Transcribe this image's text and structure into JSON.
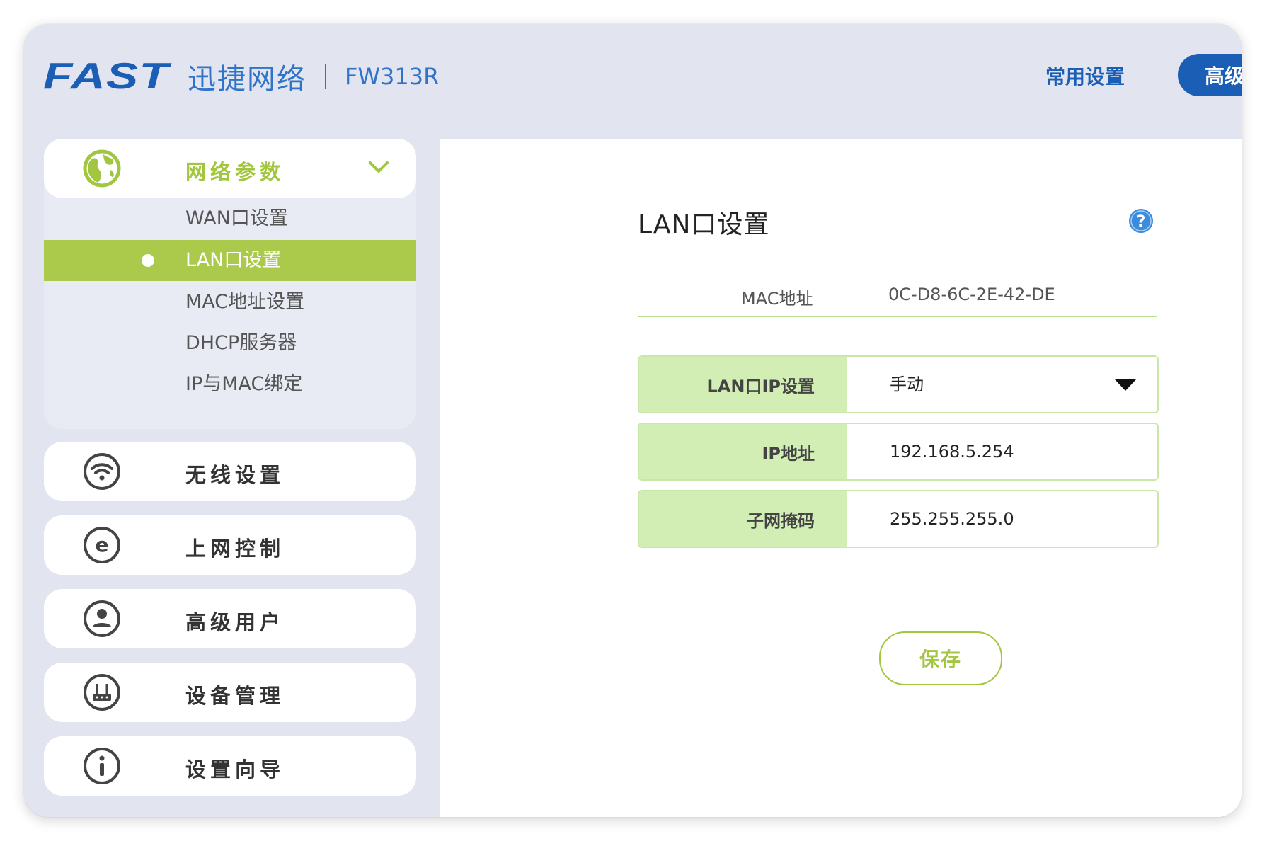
{
  "header": {
    "brand": "FAST",
    "brand_cn": "迅捷网络",
    "model": "FW313R",
    "nav_common": "常用设置",
    "nav_advanced": "高级"
  },
  "sidebar": {
    "network": {
      "label": "网络参数",
      "icon": "globe-icon",
      "sub_items": [
        {
          "label": "WAN口设置"
        },
        {
          "label": "LAN口设置",
          "active": true
        },
        {
          "label": "MAC地址设置"
        },
        {
          "label": "DHCP服务器"
        },
        {
          "label": "IP与MAC绑定"
        }
      ]
    },
    "menu": [
      {
        "label": "无线设置",
        "icon": "wifi-icon"
      },
      {
        "label": "上网控制",
        "icon": "internet-e-icon"
      },
      {
        "label": "高级用户",
        "icon": "user-icon"
      },
      {
        "label": "设备管理",
        "icon": "router-icon"
      },
      {
        "label": "设置向导",
        "icon": "info-icon"
      }
    ]
  },
  "main": {
    "title": "LAN口设置",
    "mac": {
      "label": "MAC地址",
      "value": "0C-D8-6C-2E-42-DE"
    },
    "fields": {
      "ip_mode": {
        "label": "LAN口IP设置",
        "value": "手动"
      },
      "ip": {
        "label": "IP地址",
        "value": "192.168.5.254"
      },
      "mask": {
        "label": "子网掩码",
        "value": "255.255.255.0"
      }
    },
    "save_label": "保存"
  },
  "colors": {
    "brand_blue": "#1a5eb5",
    "accent_green": "#abc94a",
    "label_bg_green": "#d2eeb5",
    "window_bg": "#e2e5f0"
  }
}
